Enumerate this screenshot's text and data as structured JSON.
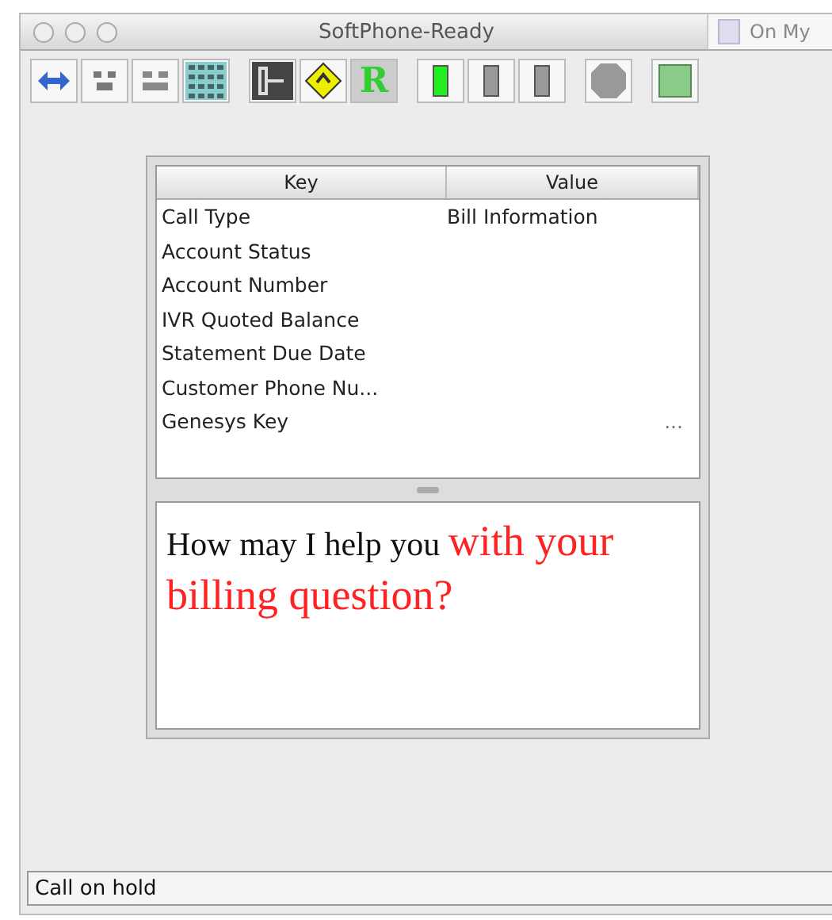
{
  "window": {
    "title": "SoftPhone-Ready"
  },
  "background_window": {
    "title": "On My"
  },
  "toolbar": [
    {
      "kind": "dial"
    },
    {
      "kind": "hold"
    },
    {
      "kind": "conference"
    },
    {
      "kind": "keypad"
    },
    {
      "kind": "logout"
    },
    {
      "kind": "sign"
    },
    {
      "kind": "letter",
      "label": "R"
    },
    {
      "kind": "slot",
      "on": true
    },
    {
      "kind": "slot",
      "on": false
    },
    {
      "kind": "slot",
      "on": false
    },
    {
      "kind": "stop"
    },
    {
      "kind": "square"
    }
  ],
  "table": {
    "columns": [
      "Key",
      "Value"
    ],
    "rows": [
      {
        "key": "Call Type",
        "value": "Bill Information"
      },
      {
        "key": "Account Status"
      },
      {
        "key": "Account Number"
      },
      {
        "key": "IVR Quoted Balance"
      },
      {
        "key": "Statement Due Date"
      },
      {
        "key": "Customer Phone Nu..."
      },
      {
        "key": "Genesys Key",
        "value": "..."
      }
    ]
  },
  "message": [
    {
      "kind": "normal",
      "text": "How may I help you "
    },
    {
      "kind": "emphasis",
      "text": "with your billing question?"
    }
  ],
  "status_bar": {
    "text": "Call on hold"
  }
}
